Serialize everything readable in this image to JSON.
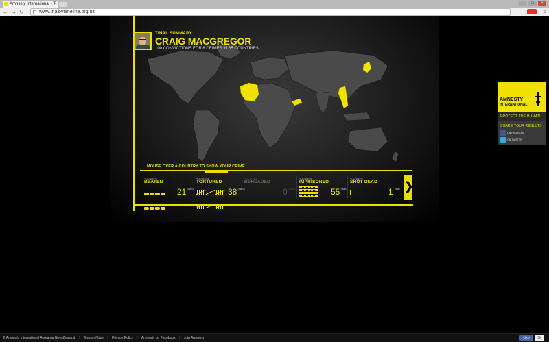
{
  "browser": {
    "tab_title": "Amnesty International - T",
    "tab_close": "×",
    "url": "www.trialbytimeline.org.nz",
    "back": "←",
    "forward": "→",
    "reload": "↻",
    "menu": "≡",
    "minimize": "–",
    "maximize": "□",
    "close": "×"
  },
  "summary": {
    "label": "TRIAL SUMMARY",
    "name": "CRAIG MACGREGOR",
    "subtitle": "100 CONVICTIONS FOR 8 CRIMES IN 65 COUNTRIES"
  },
  "map": {
    "hint": "MOUSE OVER A COUNTRY TO SHOW YOUR CRIME",
    "highlight_color": "#f2e200"
  },
  "crimes": [
    {
      "pre": "YOU WERE",
      "name": "BEATEN",
      "count": "21",
      "times": "TIMES",
      "active": true
    },
    {
      "pre": "YOU WERE",
      "name": "TORTURED",
      "count": "38",
      "times": "TIMES",
      "active": true
    },
    {
      "pre": "YOU WERE",
      "name": "BEHEADED",
      "count": "0",
      "times": "TIMES",
      "active": false
    },
    {
      "pre": "YOU WERE",
      "name": "IMPRISONED",
      "count": "55",
      "times": "TIMES",
      "active": true
    },
    {
      "pre": "YOU WERE",
      "name": "SHOT DEAD",
      "count": "1",
      "times": "TIME",
      "active": true
    }
  ],
  "next_arrow": "❯",
  "amnesty": {
    "title": "AMNESTY",
    "title2": "INTERNATIONAL",
    "protect": "PROTECT THE HUMAN",
    "share_title": "SHARE YOUR RESULTS",
    "facebook": "ON FACEBOOK",
    "twitter": "ON TWITTER"
  },
  "footer": {
    "copyright": "© Amnesty International Aotearoa New Zealand",
    "terms": "Terms of Use",
    "privacy": "Privacy Policy",
    "facebook": "Amnesty on Facebook",
    "join": "Join Amnesty",
    "separator": "|",
    "like": "Like",
    "like_count": "5k"
  },
  "colors": {
    "accent": "#e8e000",
    "background": "#000000"
  }
}
